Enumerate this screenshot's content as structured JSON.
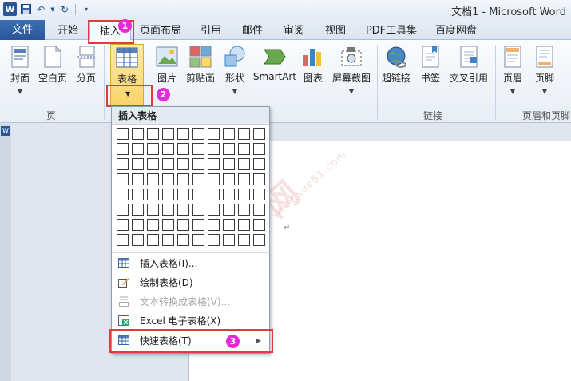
{
  "titlebar": {
    "title": "文档1  -  Microsoft Word",
    "app_logo": "W"
  },
  "tabs": {
    "file": "文件",
    "items": [
      "开始",
      "插入",
      "页面布局",
      "引用",
      "邮件",
      "审阅",
      "视图",
      "PDF工具集",
      "百度网盘"
    ],
    "active": "插入"
  },
  "ribbon": {
    "buttons": [
      "封面",
      "空白页",
      "分页",
      "表格",
      "图片",
      "剪贴画",
      "形状",
      "SmartArt",
      "图表",
      "屏幕截图",
      "超链接",
      "书签",
      "交叉引用",
      "页眉",
      "页脚"
    ],
    "groups": [
      "页",
      "链接",
      "页眉和页脚"
    ]
  },
  "badges": [
    "1",
    "2",
    "3"
  ],
  "dropdown": {
    "header": "插入表格",
    "items": [
      {
        "label": "插入表格(I)...",
        "icon": "table-icon",
        "disabled": false
      },
      {
        "label": "绘制表格(D)",
        "icon": "pencil-table-icon",
        "disabled": false
      },
      {
        "label": "文本转换成表格(V)...",
        "icon": "convert-text-icon",
        "disabled": true
      },
      {
        "label": "Excel 电子表格(X)",
        "icon": "excel-icon",
        "disabled": false
      },
      {
        "label": "快速表格(T)",
        "icon": "quick-table-icon",
        "disabled": false
      }
    ]
  },
  "watermark": {
    "main": "学网",
    "sub": "www.xue51.com"
  },
  "colors": {
    "file_tab": "#2a5699",
    "highlight": "#e23b3b",
    "badge": "#e62ad6"
  }
}
